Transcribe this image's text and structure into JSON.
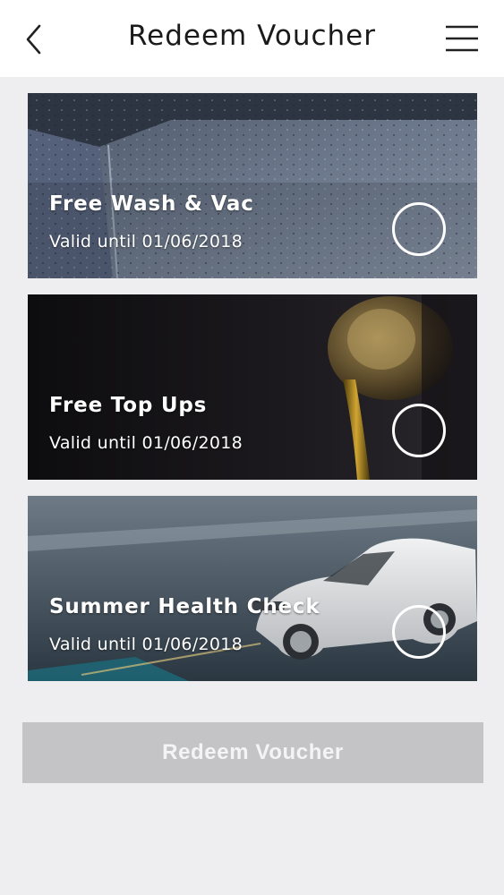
{
  "header": {
    "title": "Redeem Voucher",
    "back_icon": "chevron-left-icon",
    "menu_icon": "hamburger-menu-icon"
  },
  "vouchers": [
    {
      "title": "Free Wash & Vac",
      "valid": "Valid until 01/06/2018",
      "selected": false
    },
    {
      "title": "Free Top Ups",
      "valid": "Valid until 01/06/2018",
      "selected": false
    },
    {
      "title": "Summer Health Check",
      "valid": "Valid until 01/06/2018",
      "selected": false
    }
  ],
  "redeem_button": {
    "label": "Redeem Voucher",
    "enabled": false
  },
  "colors": {
    "background": "#eeedef",
    "header": "#ffffff",
    "button_disabled": "#c4c4c6"
  }
}
